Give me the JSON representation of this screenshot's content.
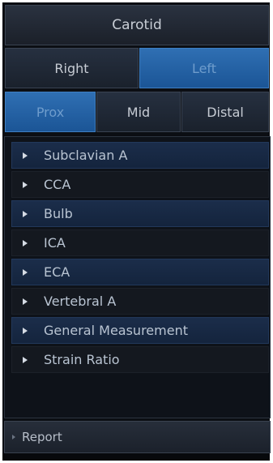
{
  "title": "Carotid",
  "side": {
    "right": "Right",
    "left": "Left",
    "selected": "Left"
  },
  "segment": {
    "prox": "Prox",
    "mid": "Mid",
    "distal": "Distal",
    "selected": "Prox"
  },
  "vessels": [
    {
      "label": "Subclavian A"
    },
    {
      "label": "CCA"
    },
    {
      "label": "Bulb"
    },
    {
      "label": "ICA"
    },
    {
      "label": "ECA"
    },
    {
      "label": "Vertebral A"
    },
    {
      "label": "General Measurement"
    },
    {
      "label": "Strain Ratio"
    }
  ],
  "report": {
    "label": "Report"
  },
  "colors": {
    "selected_tab": "#2a66aa",
    "panel_bg": "#0b0e13",
    "row_blue": "#1b2d4a",
    "row_dark": "#14181f"
  }
}
